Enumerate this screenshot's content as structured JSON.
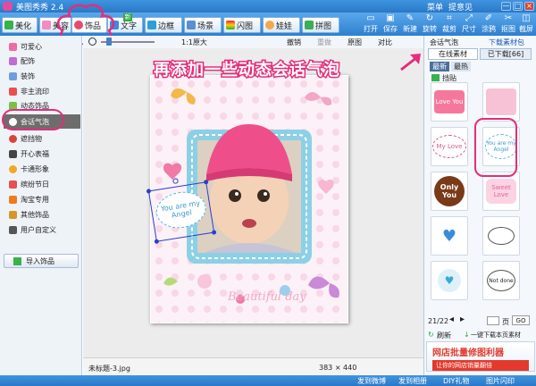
{
  "titlebar": {
    "title": "美图秀秀 2.4",
    "menu": "菜单",
    "feedback": "提意见",
    "min": "—",
    "max": "□",
    "close": "×"
  },
  "tabs": [
    "美化",
    "美容",
    "饰品",
    "文字",
    "边框",
    "场景",
    "闪图",
    "娃娃",
    "拼图"
  ],
  "new_badge": "新",
  "right_tools": [
    "打开",
    "保存",
    "新建",
    "旋转",
    "裁剪",
    "尺寸",
    "涂鸦",
    "抠图",
    "截屏"
  ],
  "sidebar": {
    "items": [
      "可爱心",
      "配饰",
      "装饰",
      "非主流印",
      "动态饰品",
      "会话气泡",
      "遮挡物",
      "开心表福",
      "卡通形象",
      "缤纷节日",
      "淘宝专用",
      "其他饰品",
      "用户自定义"
    ],
    "selected": 5,
    "import_btn": "导入饰品"
  },
  "ctrl": {
    "zoom": "1:1原大",
    "undo": "撤销",
    "redo": "重做",
    "original": "原图",
    "compare": "对比"
  },
  "photo": {
    "bubble_text": "You are my Angel",
    "caption": "Beautiful day"
  },
  "annotation": "再添加一些动态会话气泡",
  "rpanel": {
    "title": "会话气泡",
    "download": "下载素材包",
    "tab_online": "在线素材",
    "tab_downloaded": "已下载[66]",
    "sort_new": "最新",
    "sort_hot": "最热",
    "filter": "挡贴",
    "page": "21/22",
    "page_input": "",
    "go": "页",
    "go_btn": "GO",
    "refresh": "刷新",
    "download_page": "一键下载本页素材",
    "ad1": "网店批量修图利器",
    "ad2": "让你的网店销量翻倍"
  },
  "stickers": [
    "Love You",
    "",
    "My Love",
    "You are my Angel",
    "Only You",
    "Sweet Love",
    "",
    "",
    "",
    "Not done"
  ],
  "status": {
    "filename": "未标题-3.jpg",
    "dims": "383 × 440"
  },
  "bottom": {
    "share1": "发到微博",
    "share2": "发到相册",
    "share3": "DIY礼物",
    "share4": "图片闪印"
  },
  "colors": {
    "accent": "#e62c7a",
    "brand": "#2e7fcf"
  }
}
